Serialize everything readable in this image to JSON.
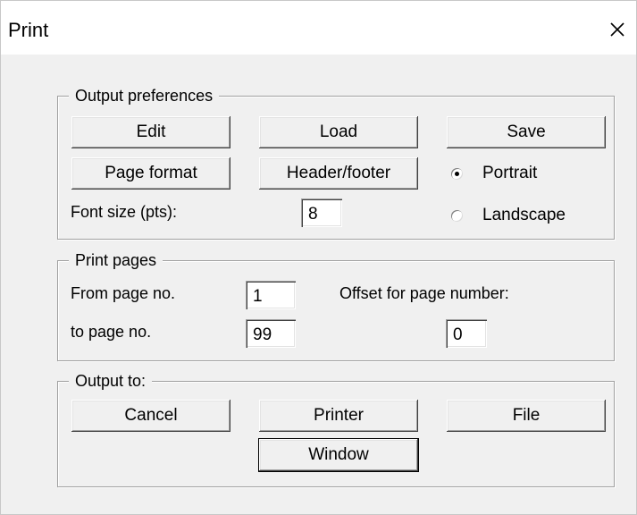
{
  "window": {
    "title": "Print",
    "close_icon": "close-icon"
  },
  "output_preferences": {
    "legend": "Output preferences",
    "edit_label": "Edit",
    "load_label": "Load",
    "save_label": "Save",
    "page_format_label": "Page format",
    "header_footer_label": "Header/footer",
    "font_size_label": "Font size (pts):",
    "font_size_value": "8",
    "orientation": {
      "selected": "Portrait",
      "portrait_label": "Portrait",
      "landscape_label": "Landscape"
    }
  },
  "print_pages": {
    "legend": "Print pages",
    "from_label": "From page no.",
    "from_value": "1",
    "to_label": "to page no.",
    "to_value": "99",
    "offset_label": "Offset for page number:",
    "offset_value": "0"
  },
  "output_to": {
    "legend": "Output to:",
    "cancel_label": "Cancel",
    "printer_label": "Printer",
    "file_label": "File",
    "window_label": "Window"
  }
}
